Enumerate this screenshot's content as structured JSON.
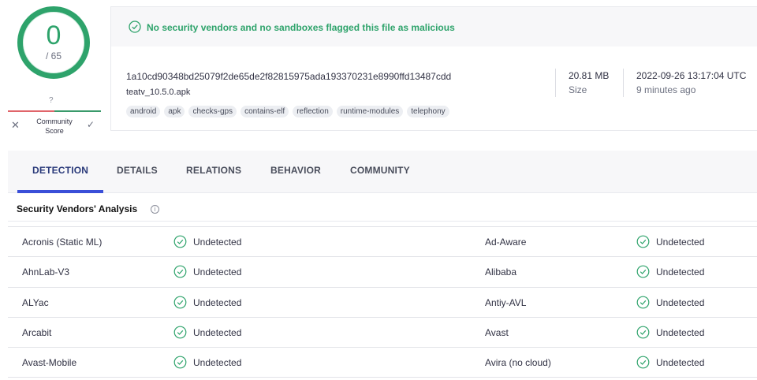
{
  "score": {
    "detections": "0",
    "total": "/ 65",
    "color": "#2ea36b"
  },
  "community": {
    "unknown": "?",
    "label_line1": "Community",
    "label_line2": "Score",
    "dislike_icon": "close-icon",
    "like_icon": "check-icon"
  },
  "banner": {
    "icon": "check-circle-icon",
    "text": "No security vendors and no sandboxes flagged this file as malicious"
  },
  "file": {
    "hash": "1a10cd90348bd25079f2de65de2f82815975ada193370231e8990ffd13487cdd",
    "name": "teatv_10.5.0.apk",
    "tags": [
      "android",
      "apk",
      "checks-gps",
      "contains-elf",
      "reflection",
      "runtime-modules",
      "telephony"
    ],
    "size_value": "20.81 MB",
    "size_label": "Size",
    "date_value": "2022-09-26 13:17:04 UTC",
    "date_label": "9 minutes ago"
  },
  "tabs": [
    {
      "label": "DETECTION",
      "active": true
    },
    {
      "label": "DETAILS",
      "active": false
    },
    {
      "label": "RELATIONS",
      "active": false
    },
    {
      "label": "BEHAVIOR",
      "active": false
    },
    {
      "label": "COMMUNITY",
      "active": false
    }
  ],
  "section": {
    "title": "Security Vendors' Analysis",
    "info_icon": "info-icon"
  },
  "vendors": [
    {
      "left": {
        "name": "Acronis (Static ML)",
        "result": "Undetected"
      },
      "right": {
        "name": "Ad-Aware",
        "result": "Undetected"
      }
    },
    {
      "left": {
        "name": "AhnLab-V3",
        "result": "Undetected"
      },
      "right": {
        "name": "Alibaba",
        "result": "Undetected"
      }
    },
    {
      "left": {
        "name": "ALYac",
        "result": "Undetected"
      },
      "right": {
        "name": "Antiy-AVL",
        "result": "Undetected"
      }
    },
    {
      "left": {
        "name": "Arcabit",
        "result": "Undetected"
      },
      "right": {
        "name": "Avast",
        "result": "Undetected"
      }
    },
    {
      "left": {
        "name": "Avast-Mobile",
        "result": "Undetected"
      },
      "right": {
        "name": "Avira (no cloud)",
        "result": "Undetected"
      }
    }
  ],
  "colors": {
    "success": "#2ea36b",
    "tab_accent": "#3a4fd8"
  }
}
